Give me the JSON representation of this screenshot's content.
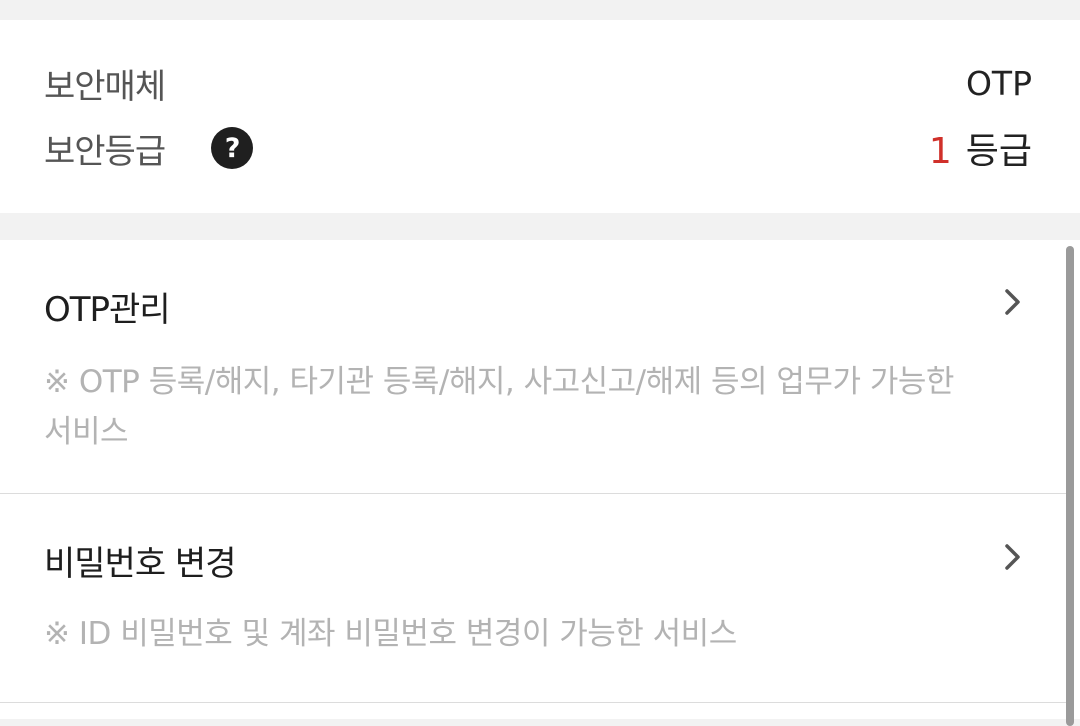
{
  "security": {
    "medium_label": "보안매체",
    "medium_value": "OTP",
    "grade_label": "보안등급",
    "grade_number": "1",
    "grade_unit": "등급",
    "help_icon_glyph": "?"
  },
  "menu": {
    "items": [
      {
        "title": "OTP관리",
        "description": "※ OTP 등록/해지, 타기관 등록/해지, 사고신고/해제 등의 업무가 가능한 서비스",
        "icon": "chevron-right-icon"
      },
      {
        "title": "비밀번호 변경",
        "description": "※ ID 비밀번호 및 계좌 비밀번호 변경이 가능한 서비스",
        "icon": "chevron-right-icon"
      }
    ]
  },
  "colors": {
    "grade_accent": "#d0302a",
    "background": "#f2f2f2",
    "card": "#ffffff",
    "description_text": "#b3b3b3"
  }
}
